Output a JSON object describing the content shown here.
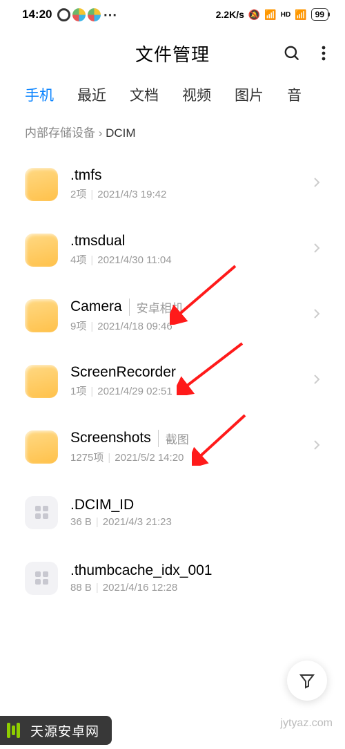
{
  "status": {
    "time": "14:20",
    "net_speed": "2.2K/s",
    "hd_label": "HD",
    "battery": "99"
  },
  "header": {
    "title": "文件管理"
  },
  "tabs": [
    "手机",
    "最近",
    "文档",
    "视频",
    "图片",
    "音"
  ],
  "active_tab_index": 0,
  "breadcrumb": {
    "root": "内部存储设备",
    "current": "DCIM"
  },
  "files": [
    {
      "kind": "folder",
      "name": ".tmfs",
      "tag": "",
      "count": "2项",
      "date": "2021/4/3 19:42"
    },
    {
      "kind": "folder",
      "name": ".tmsdual",
      "tag": "",
      "count": "4项",
      "date": "2021/4/30 11:04"
    },
    {
      "kind": "folder",
      "name": "Camera",
      "tag": "安卓相机",
      "count": "9项",
      "date": "2021/4/18 09:46"
    },
    {
      "kind": "folder",
      "name": "ScreenRecorder",
      "tag": "",
      "count": "1项",
      "date": "2021/4/29 02:51"
    },
    {
      "kind": "folder",
      "name": "Screenshots",
      "tag": "截图",
      "count": "1275项",
      "date": "2021/5/2 14:20"
    },
    {
      "kind": "file",
      "name": ".DCIM_ID",
      "tag": "",
      "count": "36 B",
      "date": "2021/4/3 21:23"
    },
    {
      "kind": "file",
      "name": ".thumbcache_idx_001",
      "tag": "",
      "count": "88 B",
      "date": "2021/4/16 12:28"
    }
  ],
  "banner": {
    "text": "天源安卓网",
    "domain": "jytyaz.com"
  }
}
